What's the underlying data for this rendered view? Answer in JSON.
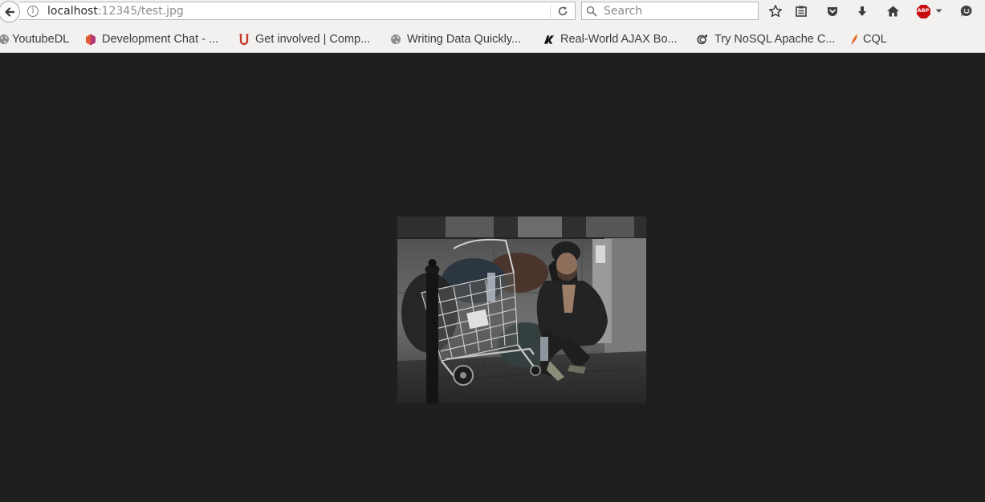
{
  "browser": {
    "url": {
      "host": "localhost",
      "rest": ":12345/test.jpg"
    },
    "search": {
      "placeholder": "Search"
    },
    "toolbar_icons": [
      "star-icon",
      "reading-list-icon",
      "pocket-icon",
      "download-icon",
      "home-icon",
      "adblock-icon",
      "chevron-down-icon",
      "smiley-icon"
    ],
    "adblock_label": "ABP"
  },
  "bookmarks": [
    {
      "label": "YoutubeDL",
      "icon": "globe-icon"
    },
    {
      "label": "Development Chat - ...",
      "icon": "hexagon-icon"
    },
    {
      "label": "Get involved | Comp...",
      "icon": "ubuntu-icon"
    },
    {
      "label": "Writing Data Quickly...",
      "icon": "globe-icon"
    },
    {
      "label": "Real-World AJAX Bo...",
      "icon": "logo-icon"
    },
    {
      "label": "Try NoSQL Apache C...",
      "icon": "at-icon"
    },
    {
      "label": "CQL",
      "icon": "feather-icon"
    }
  ],
  "colors": {
    "page_background": "#1f1f1f",
    "toolbar_background": "#f2f1f0",
    "adblock_red": "#c70d0d"
  },
  "content": {
    "image_name": "test.jpg"
  }
}
